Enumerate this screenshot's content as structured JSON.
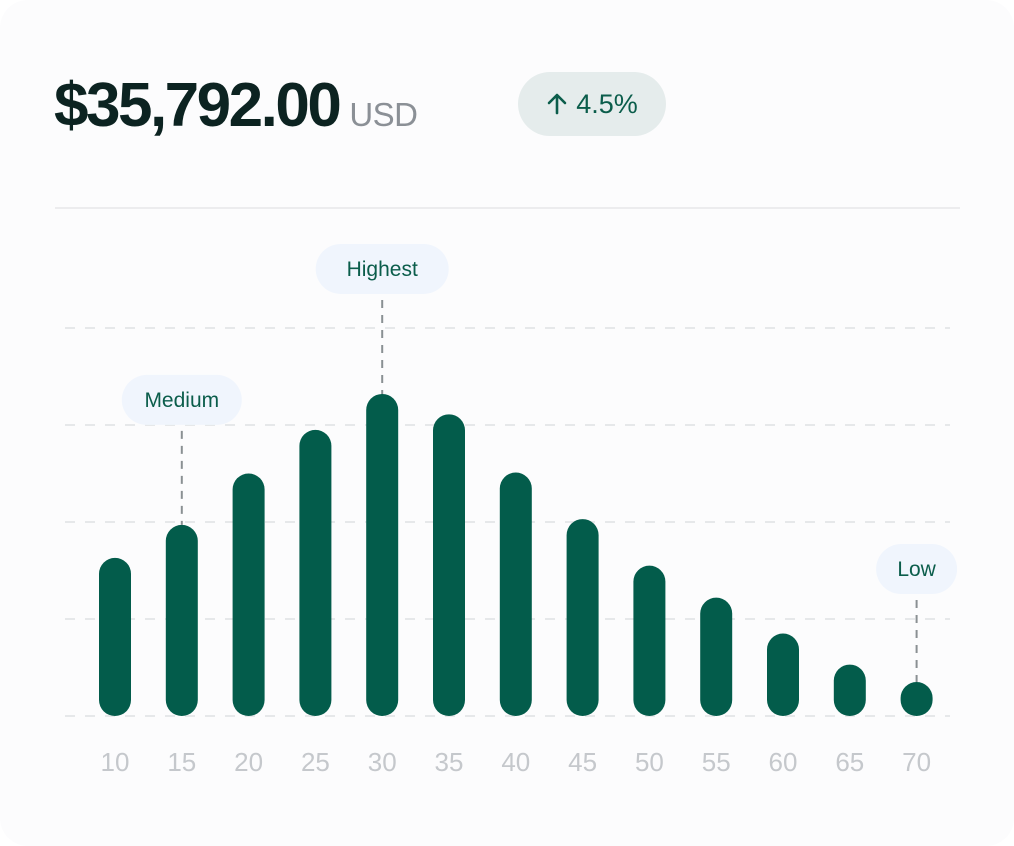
{
  "summary": {
    "amount": "$35,792.00",
    "currency": "USD",
    "change": "4.5%",
    "change_direction": "up",
    "change_icon": "arrow-up-icon"
  },
  "colors": {
    "bar": "#035c4b",
    "badge_bg": "#e5ecec",
    "badge_text": "#0b5d4b",
    "callout_bg": "#f0f5fd",
    "callout_text": "#0b5d4b",
    "tick_label": "#c5c8cc",
    "gridline": "#e6e8ea"
  },
  "chart_data": {
    "type": "bar",
    "categories": [
      "10",
      "15",
      "20",
      "25",
      "30",
      "35",
      "40",
      "45",
      "50",
      "55",
      "60",
      "65",
      "70"
    ],
    "values": [
      1.63,
      1.97,
      2.5,
      2.95,
      3.32,
      3.11,
      2.51,
      2.03,
      1.55,
      1.22,
      0.85,
      0.53,
      0.35
    ],
    "ylim": [
      0,
      4
    ],
    "grid": true,
    "y_tick_labels_visible": false,
    "annotations": [
      {
        "label": "Medium",
        "category": "15"
      },
      {
        "label": "Highest",
        "category": "30"
      },
      {
        "label": "Low",
        "category": "70"
      }
    ]
  }
}
